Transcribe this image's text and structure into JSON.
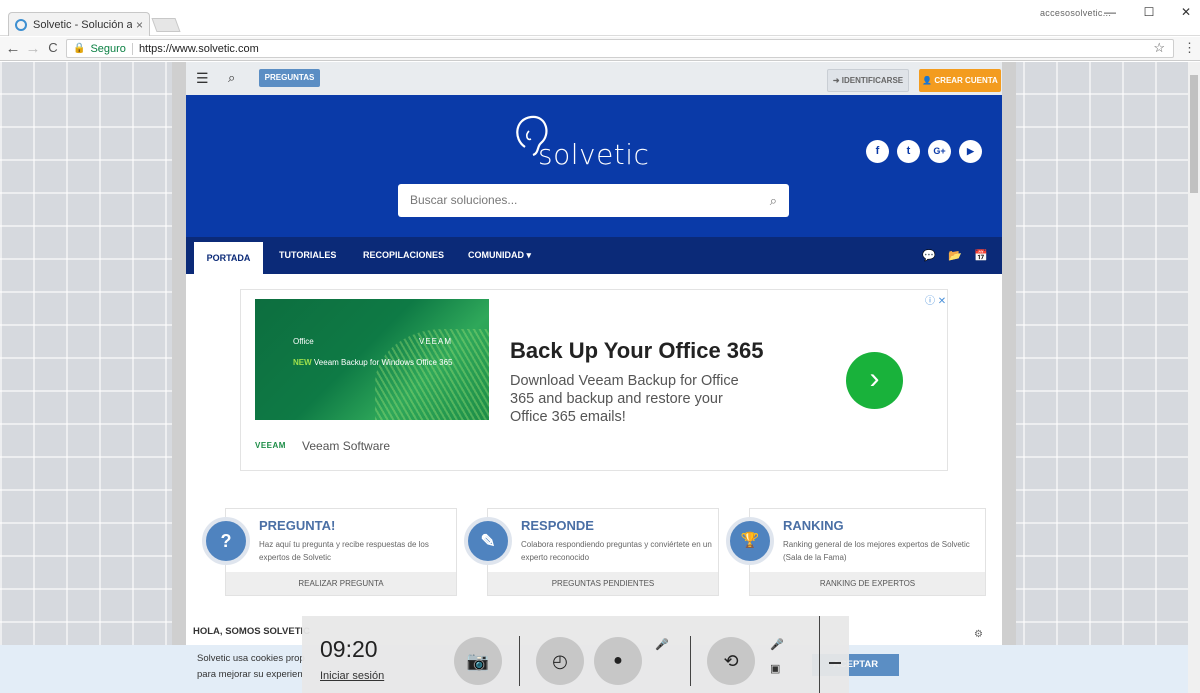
{
  "browser": {
    "tab_title": "Solvetic - Solución a los p",
    "tab_close": "×",
    "profile": "accesosolvetic...",
    "win_minimize": "—",
    "win_maximize": "☐",
    "win_close": "✕",
    "back": "←",
    "forward": "→",
    "reload": "C",
    "secure_label": "Seguro",
    "url": "https://www.solvetic.com",
    "bookmark": "☆",
    "menu": "⋮"
  },
  "site": {
    "topnav": {
      "menu_icon": "☰",
      "search_icon": "⌕",
      "preguntas": "PREGUNTAS",
      "identificarse": "➜ IDENTIFICARSE",
      "crear_cuenta": "👤 CREAR CUENTA"
    },
    "hero": {
      "logo_text": "solvetic",
      "social": [
        "f",
        "t",
        "G+",
        "▶"
      ],
      "search_placeholder": "Buscar soluciones...",
      "search_icon": "⌕"
    },
    "mainnav": {
      "items": [
        "PORTADA",
        "TUTORIALES",
        "RECOPILACIONES",
        "COMUNIDAD ▾"
      ],
      "icons": [
        "💬",
        "📂",
        "📅"
      ]
    },
    "ad": {
      "img_office": "Office",
      "img_veeam": "VEEAM",
      "img_new": "NEW",
      "img_new_text": " Veeam Backup for Windows Office 365",
      "title": "Back Up Your Office 365",
      "body": "Download Veeam Backup for Office 365 and backup and restore your Office 365 emails!",
      "go": "›",
      "brand_logo": "VEEAM",
      "brand": "Veeam Software",
      "info": "ⓘ ✕"
    },
    "cards": [
      {
        "icon": "?",
        "title": "PREGUNTA!",
        "desc": "Haz aquí tu pregunta y recibe respuestas de los expertos de Solvetic",
        "foot": "REALIZAR PREGUNTA"
      },
      {
        "icon": "✎",
        "title": "RESPONDE",
        "desc": "Colabora respondiendo preguntas y conviértete en un experto reconocido",
        "foot": "PREGUNTAS PENDIENTES"
      },
      {
        "icon": "🏆",
        "title": "RANKING",
        "desc": "Ranking general de los mejores expertos de Solvetic (Sala de la Fama)",
        "foot": "RANKING DE EXPERTOS"
      }
    ],
    "hola": "HOLA, SOMOS SOLVETIC",
    "cookie": {
      "line1": "Solvetic usa cookies prop",
      "line2": "para mejorar su experien",
      "accept": "ACEPTAR"
    }
  },
  "overlay": {
    "time": "09:20",
    "login": "Iniciar sesión",
    "camera_icon": "📷",
    "timer_icon": "◴",
    "record_icon": "●",
    "mic_off_icon": "🎤",
    "stabilize_icon": "⟲",
    "mic_icon": "🎤",
    "video_off_icon": "▣"
  }
}
